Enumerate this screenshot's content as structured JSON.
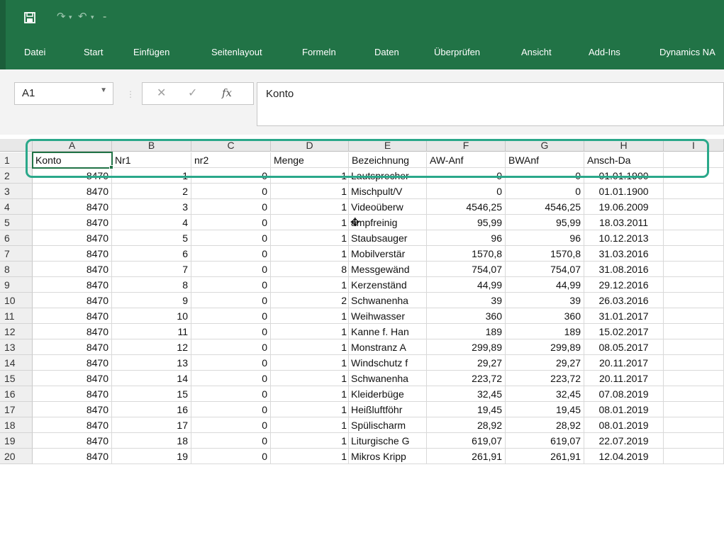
{
  "colors": {
    "accent": "#217346",
    "highlight": "#2aa88a"
  },
  "quick_access": {
    "save_icon": "save-icon",
    "redo_glyph": "↷",
    "undo_glyph": "↶",
    "dropdown_glyph": "▾",
    "customize_glyph": "₌"
  },
  "ribbon": {
    "tabs": [
      "Datei",
      "Start",
      "Einfügen",
      "Seitenlayout",
      "Formeln",
      "Daten",
      "Überprüfen",
      "Ansicht",
      "Add-Ins",
      "Dynamics NA"
    ]
  },
  "formula_bar": {
    "name_box": "A1",
    "name_box_arrow": "▼",
    "separator": "⋮",
    "cancel_glyph": "✕",
    "enter_glyph": "✓",
    "fx_glyph": "fx",
    "content": "Konto"
  },
  "sheet": {
    "columns": [
      "A",
      "B",
      "C",
      "D",
      "E",
      "F",
      "G",
      "H",
      "I"
    ],
    "header_row": [
      "Konto",
      "Nr1",
      "nr2",
      "Menge",
      "Bezeichnung",
      "AW-Anf",
      "BWAnf",
      "Ansch-Da"
    ],
    "row_numbers": [
      "1",
      "2",
      "3",
      "4",
      "5",
      "6",
      "7",
      "8",
      "9",
      "10",
      "11",
      "12",
      "13",
      "14",
      "15",
      "16",
      "17",
      "18",
      "19",
      "20"
    ],
    "rows": [
      [
        "8470",
        "1",
        "0",
        "1",
        "Lautsprecher",
        "0",
        "0",
        "01.01.1900"
      ],
      [
        "8470",
        "2",
        "0",
        "1",
        "Mischpult/V",
        "0",
        "0",
        "01.01.1900"
      ],
      [
        "8470",
        "3",
        "0",
        "1",
        "Videoüberw",
        "4546,25",
        "4546,25",
        "19.06.2009"
      ],
      [
        "8470",
        "4",
        "0",
        "1",
        "ampfreinig",
        "95,99",
        "95,99",
        "18.03.2011"
      ],
      [
        "8470",
        "5",
        "0",
        "1",
        "Staubsauger",
        "96",
        "96",
        "10.12.2013"
      ],
      [
        "8470",
        "6",
        "0",
        "1",
        "Mobilverstär",
        "1570,8",
        "1570,8",
        "31.03.2016"
      ],
      [
        "8470",
        "7",
        "0",
        "8",
        "Messgewänd",
        "754,07",
        "754,07",
        "31.08.2016"
      ],
      [
        "8470",
        "8",
        "0",
        "1",
        "Kerzenständ",
        "44,99",
        "44,99",
        "29.12.2016"
      ],
      [
        "8470",
        "9",
        "0",
        "2",
        "Schwanenha",
        "39",
        "39",
        "26.03.2016"
      ],
      [
        "8470",
        "10",
        "0",
        "1",
        "Weihwasser",
        "360",
        "360",
        "31.01.2017"
      ],
      [
        "8470",
        "11",
        "0",
        "1",
        "Kanne f. Han",
        "189",
        "189",
        "15.02.2017"
      ],
      [
        "8470",
        "12",
        "0",
        "1",
        "Monstranz A",
        "299,89",
        "299,89",
        "08.05.2017"
      ],
      [
        "8470",
        "13",
        "0",
        "1",
        "Windschutz f",
        "29,27",
        "29,27",
        "20.11.2017"
      ],
      [
        "8470",
        "14",
        "0",
        "1",
        "Schwanenha",
        "223,72",
        "223,72",
        "20.11.2017"
      ],
      [
        "8470",
        "15",
        "0",
        "1",
        "Kleiderbüge",
        "32,45",
        "32,45",
        "07.08.2019"
      ],
      [
        "8470",
        "16",
        "0",
        "1",
        "Heißluftföhr",
        "19,45",
        "19,45",
        "08.01.2019"
      ],
      [
        "8470",
        "17",
        "0",
        "1",
        "Spülischarm",
        "28,92",
        "28,92",
        "08.01.2019"
      ],
      [
        "8470",
        "18",
        "0",
        "1",
        "Liturgische G",
        "619,07",
        "619,07",
        "22.07.2019"
      ],
      [
        "8470",
        "19",
        "0",
        "1",
        "Mikros Kripp",
        "261,91",
        "261,91",
        "12.04.2019"
      ]
    ]
  },
  "cursor_glyph": "✥"
}
